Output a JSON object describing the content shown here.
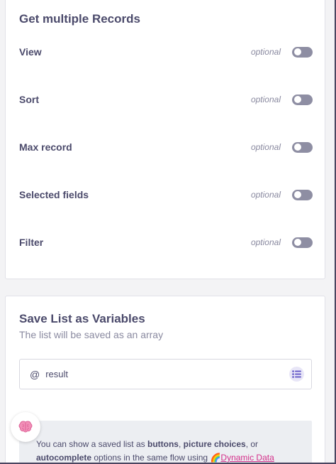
{
  "records_card": {
    "title": "Get multiple Records",
    "rows": [
      {
        "label": "View",
        "optional": "optional",
        "enabled": false
      },
      {
        "label": "Sort",
        "optional": "optional",
        "enabled": false
      },
      {
        "label": "Max record",
        "optional": "optional",
        "enabled": false
      },
      {
        "label": "Selected fields",
        "optional": "optional",
        "enabled": false
      },
      {
        "label": "Filter",
        "optional": "optional",
        "enabled": false
      }
    ]
  },
  "variables_card": {
    "title": "Save List as Variables",
    "subtitle": "The list will be saved as an array",
    "input": {
      "prefix": "@",
      "value": "result"
    },
    "tip": {
      "t1": "You can show a saved list as ",
      "b1": "buttons",
      "t2": ", ",
      "b2": "picture choices",
      "t3": ", or",
      "b3": "autocomplete",
      "t4": " options in the same flow using ",
      "emoji": "🌈",
      "link": "Dynamic Data"
    }
  },
  "icons": {
    "toggle": "toggle-switch",
    "list": "list-icon",
    "avatar": "brain-icon"
  },
  "colors": {
    "toggle_off": "#8e8ea3",
    "link": "#d42f8a",
    "tip_background": "#eceef2"
  }
}
